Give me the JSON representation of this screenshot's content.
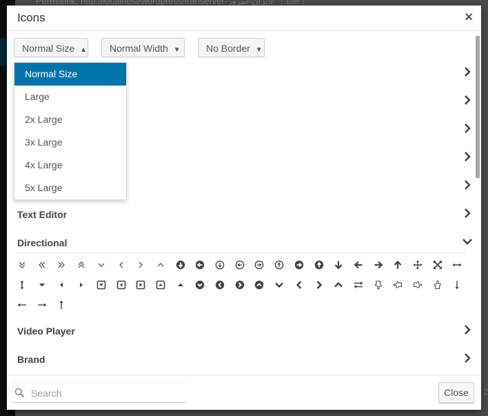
{
  "background": {
    "permalink_text": "Permalink: http://localhost/wordpress/iranserver-ایران-سرور/",
    "edit_label": "Edit",
    "bottom_fragment": "2"
  },
  "modal": {
    "title": "Icons",
    "close_symbol": "×"
  },
  "toolbar": {
    "size": {
      "label": "Normal Size",
      "caret": "▲"
    },
    "width": {
      "label": "Normal Width",
      "caret": "▼"
    },
    "border": {
      "label": "No Border",
      "caret": "▼"
    }
  },
  "size_dropdown": {
    "selected": "Normal Size",
    "options": [
      "Normal Size",
      "Large",
      "2x Large",
      "3x Large",
      "4x Large",
      "5x Large"
    ]
  },
  "categories": [
    {
      "label": "",
      "expanded": false
    },
    {
      "label": "",
      "expanded": false
    },
    {
      "label": "",
      "expanded": false
    },
    {
      "label": "",
      "expanded": false
    },
    {
      "label": "",
      "expanded": false
    },
    {
      "label": "Text Editor",
      "expanded": false
    },
    {
      "label": "Directional",
      "expanded": true
    },
    {
      "label": "Video Player",
      "expanded": false
    },
    {
      "label": "Brand",
      "expanded": false
    }
  ],
  "directional_icons": [
    "angle-double-down",
    "angle-double-left",
    "angle-double-right",
    "angle-double-up",
    "angle-down",
    "angle-left",
    "angle-right",
    "angle-up",
    "arrow-circle-down",
    "arrow-circle-left",
    "arrow-circle-o-down",
    "arrow-circle-o-left",
    "arrow-circle-o-right",
    "arrow-circle-o-up",
    "arrow-circle-right",
    "arrow-circle-up",
    "arrow-down",
    "arrow-left",
    "arrow-right",
    "arrow-up",
    "arrows",
    "arrows-alt",
    "arrows-h",
    "arrows-v",
    "caret-down",
    "caret-left",
    "caret-right",
    "caret-square-o-down",
    "caret-square-o-left",
    "caret-square-o-right",
    "caret-square-o-up",
    "caret-up",
    "chevron-circle-down",
    "chevron-circle-left",
    "chevron-circle-right",
    "chevron-circle-up",
    "chevron-down",
    "chevron-left",
    "chevron-right",
    "chevron-up",
    "exchange",
    "hand-o-down",
    "hand-o-left",
    "hand-o-right",
    "hand-o-up",
    "long-arrow-down",
    "long-arrow-left",
    "long-arrow-right",
    "long-arrow-up"
  ],
  "footer": {
    "search_placeholder": "Search",
    "search_value": "",
    "close_label": "Close"
  },
  "colors": {
    "accent": "#0073aa",
    "icon": "#444444"
  }
}
